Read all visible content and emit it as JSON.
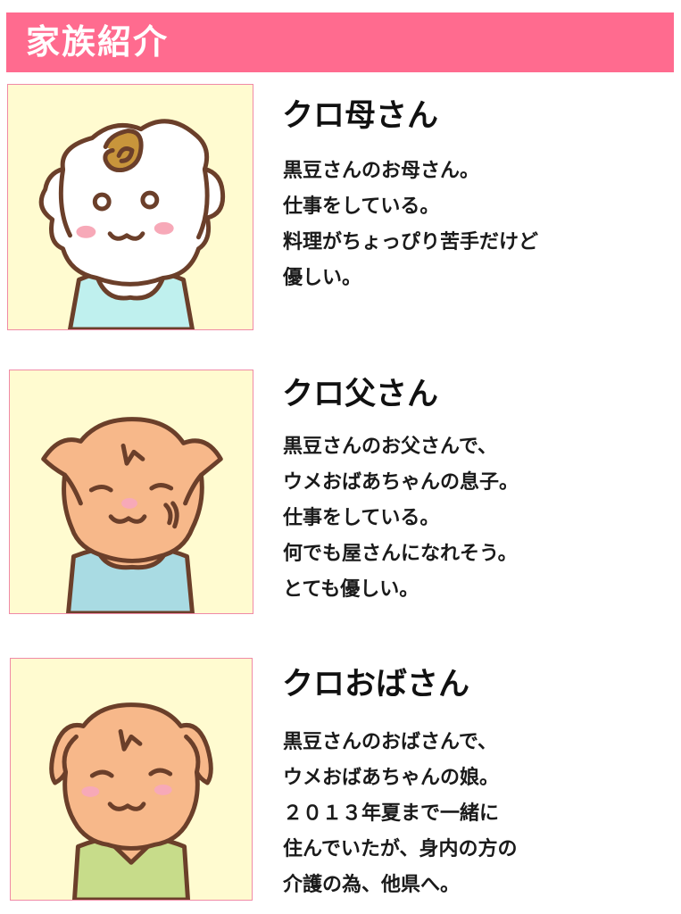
{
  "header": {
    "title": "家族紹介"
  },
  "members": [
    {
      "name": "クロ母さん",
      "lines": [
        "黒豆さんのお母さん。",
        "仕事をしている。",
        "料理がちょっぴり苦手だけど",
        "優しい。"
      ]
    },
    {
      "name": "クロ父さん",
      "lines": [
        "黒豆さんのお父さんで、",
        "ウメおばあちゃんの息子。",
        "仕事をしている。",
        "何でも屋さんになれそう。",
        "とても優しい。"
      ]
    },
    {
      "name": "クロおばさん",
      "lines": [
        "黒豆さんのおばさんで、",
        "ウメおばあちゃんの娘。",
        "２０１３年夏まで一緒に",
        "住んでいたが、身内の方の",
        "介護の為、他県へ。"
      ]
    }
  ],
  "colors": {
    "header_bg": "#ff6b8f",
    "portrait_bg": "#fffbd0",
    "portrait_border": "#f08aa6",
    "outline": "#6b3f2a",
    "mother_fur": "#ffffff",
    "mother_curl": "#c8953b",
    "mother_shirt": "#bff0ee",
    "father_fur": "#f7b88a",
    "father_shirt": "#a9dbe3",
    "aunt_fur": "#f7b88a",
    "aunt_shirt": "#c7dc8a",
    "cheek": "#f7a9b8"
  }
}
